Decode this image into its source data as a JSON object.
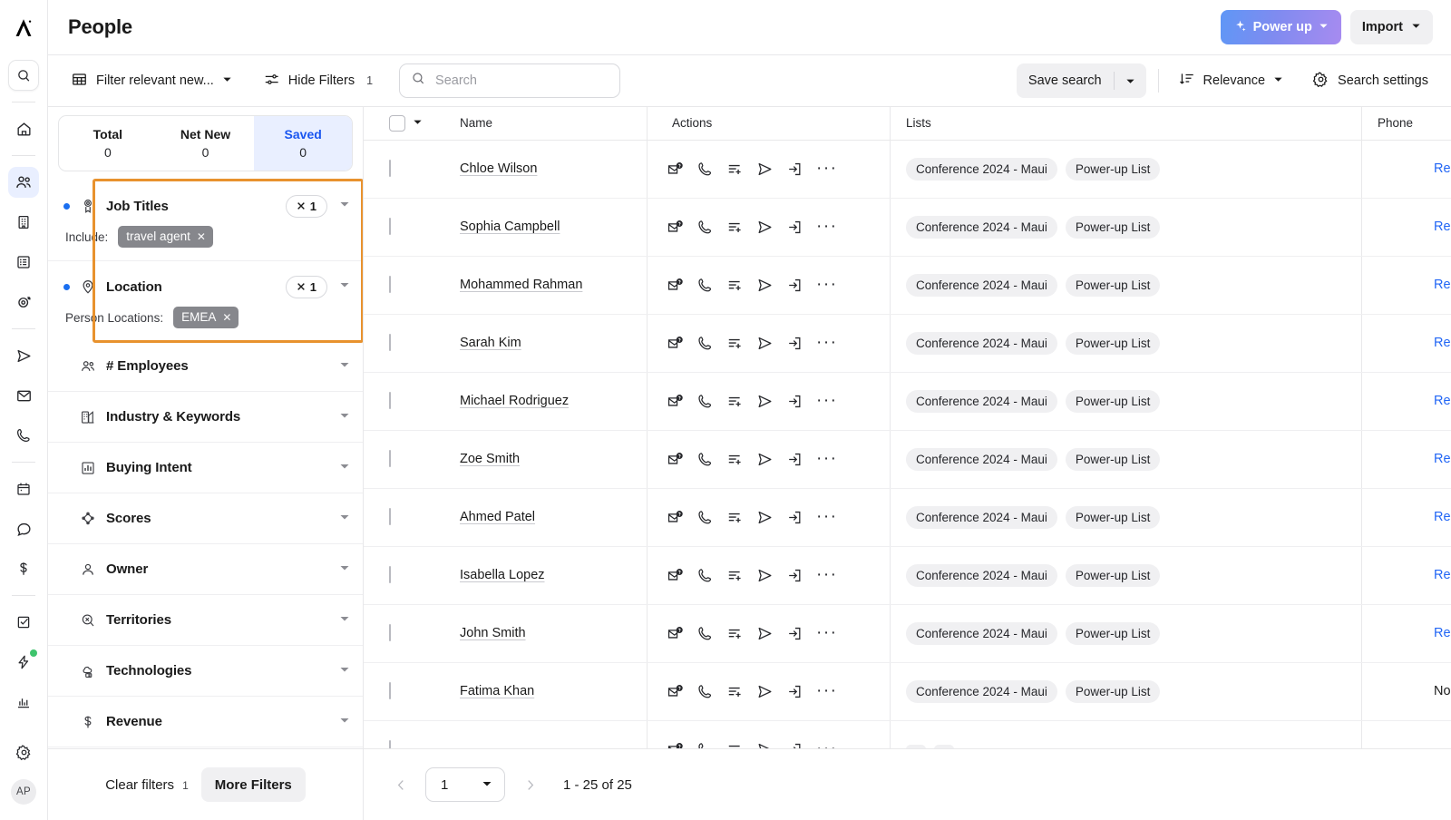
{
  "app": {
    "logo_icon": "apollo-logo-icon"
  },
  "rail": {
    "items": [
      {
        "icon": "search-icon",
        "name": "rail-search"
      },
      {
        "icon": "home-icon",
        "name": "rail-home"
      },
      {
        "icon": "people-icon",
        "name": "rail-people"
      },
      {
        "icon": "company-icon",
        "name": "rail-companies"
      },
      {
        "icon": "list-icon",
        "name": "rail-lists"
      },
      {
        "icon": "sync-icon",
        "name": "rail-enrich"
      },
      {
        "icon": "send-icon",
        "name": "rail-sequences"
      },
      {
        "icon": "mail-icon",
        "name": "rail-emails"
      },
      {
        "icon": "phone-icon",
        "name": "rail-calls"
      },
      {
        "icon": "calendar-icon",
        "name": "rail-meetings"
      },
      {
        "icon": "chat-icon",
        "name": "rail-conversations"
      },
      {
        "icon": "dollar-icon",
        "name": "rail-deals"
      },
      {
        "icon": "task-icon",
        "name": "rail-tasks"
      },
      {
        "icon": "lightning-icon",
        "name": "rail-workflows"
      },
      {
        "icon": "analytics-icon",
        "name": "rail-analytics"
      },
      {
        "icon": "gear-icon",
        "name": "rail-settings"
      }
    ],
    "avatar_initials": "AP"
  },
  "header": {
    "title": "People",
    "power_up_label": "Power up",
    "power_up_icon": "sparkle-icon",
    "import_label": "Import"
  },
  "toolbar": {
    "view_label": "Filter relevant new...",
    "view_icon": "table-icon",
    "hide_filters_label": "Hide Filters",
    "hide_filters_icon": "sliders-icon",
    "hide_filters_count": "1",
    "search_placeholder": "Search",
    "search_value": "",
    "search_icon": "search-icon",
    "save_search_label": "Save search",
    "sort_label": "Relevance",
    "sort_icon": "sort-descending-icon",
    "search_settings_label": "Search settings",
    "search_settings_icon": "gear-icon"
  },
  "filters": {
    "counts": [
      {
        "label": "Total",
        "value": "0",
        "active": false
      },
      {
        "label": "Net New",
        "value": "0",
        "active": false
      },
      {
        "label": "Saved",
        "value": "0",
        "active": true
      }
    ],
    "highlighted": [
      {
        "label": "Job Titles",
        "icon": "job-title-icon",
        "clear_count": "1",
        "value_label": "Include:",
        "chips": [
          "travel agent"
        ]
      },
      {
        "label": "Location",
        "icon": "location-pin-icon",
        "clear_count": "1",
        "value_label": "Person Locations:",
        "chips": [
          "EMEA"
        ]
      }
    ],
    "rows": [
      {
        "label": "# Employees",
        "icon": "people-icon"
      },
      {
        "label": "Industry & Keywords",
        "icon": "industry-icon"
      },
      {
        "label": "Buying Intent",
        "icon": "bar-chart-icon"
      },
      {
        "label": "Scores",
        "icon": "scores-icon"
      },
      {
        "label": "Owner",
        "icon": "person-icon"
      },
      {
        "label": "Territories",
        "icon": "territories-icon"
      },
      {
        "label": "Technologies",
        "icon": "technologies-icon"
      },
      {
        "label": "Revenue",
        "icon": "dollar-icon"
      }
    ],
    "footer": {
      "clear_filters_label": "Clear filters",
      "clear_filters_count": "1",
      "more_filters_label": "More Filters"
    },
    "highlight_color": "#e8922e",
    "accent_color": "#1a6ff0"
  },
  "table": {
    "columns": [
      "Name",
      "Actions",
      "Lists",
      "Phone"
    ],
    "action_icons": [
      "email-verify-icon",
      "phone-icon",
      "add-to-list-icon",
      "send-sequence-icon",
      "push-to-crm-icon",
      "more-actions-icon"
    ],
    "rows": [
      {
        "name": "Chloe Wilson",
        "lists": [
          "Conference 2024 - Maui",
          "Power-up List"
        ],
        "phone": "Reque",
        "phone_link": true
      },
      {
        "name": "Sophia Campbell",
        "lists": [
          "Conference 2024 - Maui",
          "Power-up List"
        ],
        "phone": "Reque",
        "phone_link": true
      },
      {
        "name": "Mohammed Rahman",
        "lists": [
          "Conference 2024 - Maui",
          "Power-up List"
        ],
        "phone": "Reque",
        "phone_link": true
      },
      {
        "name": "Sarah Kim",
        "lists": [
          "Conference 2024 - Maui",
          "Power-up List"
        ],
        "phone": "Reque",
        "phone_link": true
      },
      {
        "name": "Michael Rodriguez",
        "lists": [
          "Conference 2024 - Maui",
          "Power-up List"
        ],
        "phone": "Reque",
        "phone_link": true
      },
      {
        "name": "Zoe Smith",
        "lists": [
          "Conference 2024 - Maui",
          "Power-up List"
        ],
        "phone": "Reque",
        "phone_link": true
      },
      {
        "name": "Ahmed Patel",
        "lists": [
          "Conference 2024 - Maui",
          "Power-up List"
        ],
        "phone": "Reque",
        "phone_link": true
      },
      {
        "name": "Isabella Lopez",
        "lists": [
          "Conference 2024 - Maui",
          "Power-up List"
        ],
        "phone": "Reque",
        "phone_link": true
      },
      {
        "name": "John Smith",
        "lists": [
          "Conference 2024 - Maui",
          "Power-up List"
        ],
        "phone": "Reque",
        "phone_link": true
      },
      {
        "name": "Fatima Khan",
        "lists": [
          "Conference 2024 - Maui",
          "Power-up List"
        ],
        "phone": "No nu",
        "phone_link": false
      },
      {
        "name": "",
        "lists": [
          "",
          ""
        ],
        "phone": "",
        "phone_link": false
      }
    ]
  },
  "pagination": {
    "page_value": "1",
    "range_label": "1 - 25 of 25",
    "prev_icon": "chevron-left-icon",
    "next_icon": "chevron-right-icon"
  }
}
